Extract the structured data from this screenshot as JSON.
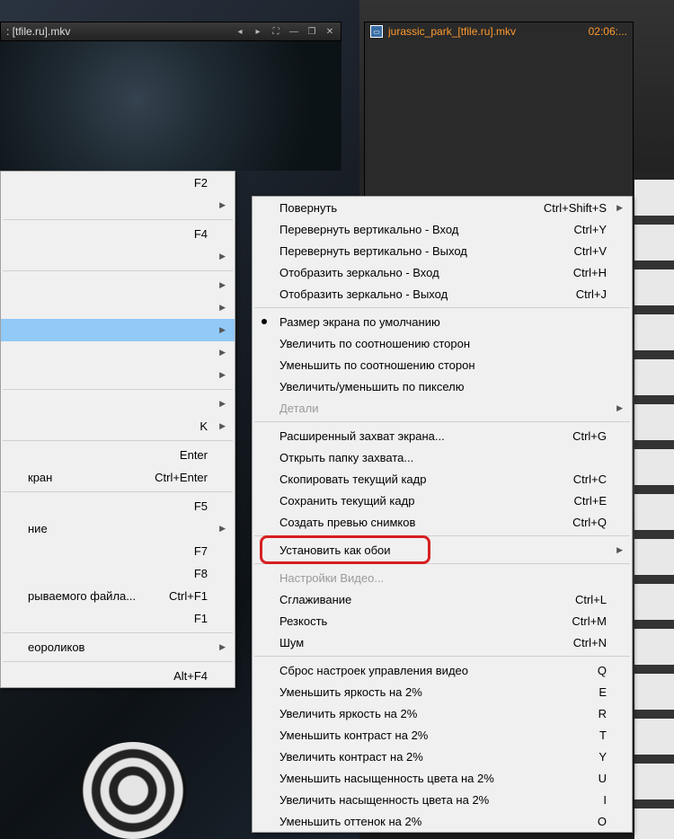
{
  "titlebar": {
    "title": ": [tfile.ru].mkv"
  },
  "playlist": {
    "filename": "jurassic_park_[tfile.ru].mkv",
    "duration": "02:06:..."
  },
  "menu_left": [
    {
      "label": "",
      "shortcut": "F2",
      "arrow": false
    },
    {
      "label": "",
      "shortcut": "",
      "arrow": true
    },
    {
      "sep": true
    },
    {
      "label": "",
      "shortcut": "F4",
      "arrow": false
    },
    {
      "label": "",
      "shortcut": "",
      "arrow": true
    },
    {
      "sep": true
    },
    {
      "label": "",
      "shortcut": "",
      "arrow": true
    },
    {
      "label": "",
      "shortcut": "",
      "arrow": true
    },
    {
      "label": "",
      "shortcut": "",
      "arrow": true,
      "highlight": true
    },
    {
      "label": "",
      "shortcut": "",
      "arrow": true
    },
    {
      "label": "",
      "shortcut": "",
      "arrow": true
    },
    {
      "sep": true
    },
    {
      "label": "",
      "shortcut": "",
      "arrow": true
    },
    {
      "label": "",
      "shortcut": "K",
      "arrow": true
    },
    {
      "sep": true
    },
    {
      "label": "",
      "shortcut": "Enter",
      "arrow": false
    },
    {
      "label": "кран",
      "shortcut": "Ctrl+Enter",
      "arrow": false
    },
    {
      "sep": true
    },
    {
      "label": "",
      "shortcut": "F5",
      "arrow": false
    },
    {
      "label": "ние",
      "shortcut": "",
      "arrow": true
    },
    {
      "label": "",
      "shortcut": "F7",
      "arrow": false
    },
    {
      "label": "",
      "shortcut": "F8",
      "arrow": false
    },
    {
      "label": "рываемого файла...",
      "shortcut": "Ctrl+F1",
      "arrow": false
    },
    {
      "label": "",
      "shortcut": "F1",
      "arrow": false
    },
    {
      "sep": true
    },
    {
      "label": "еороликов",
      "shortcut": "",
      "arrow": true
    },
    {
      "sep": true
    },
    {
      "label": "",
      "shortcut": "Alt+F4",
      "arrow": false
    }
  ],
  "menu_right": [
    {
      "label": "Повернуть",
      "shortcut": "Ctrl+Shift+S",
      "arrow": true
    },
    {
      "label": "Перевернуть вертикально - Вход",
      "shortcut": "Ctrl+Y"
    },
    {
      "label": "Перевернуть вертикально - Выход",
      "shortcut": "Ctrl+V"
    },
    {
      "label": "Отобразить зеркально - Вход",
      "shortcut": "Ctrl+H"
    },
    {
      "label": "Отобразить зеркально - Выход",
      "shortcut": "Ctrl+J"
    },
    {
      "sep": true
    },
    {
      "label": "Размер экрана по умолчанию",
      "bullet": true
    },
    {
      "label": "Увеличить по соотношению сторон"
    },
    {
      "label": "Уменьшить по соотношению сторон"
    },
    {
      "label": "Увеличить/уменьшить по пикселю"
    },
    {
      "label": "Детали",
      "disabled": true,
      "arrow": true
    },
    {
      "sep": true
    },
    {
      "label": "Расширенный захват экрана...",
      "shortcut": "Ctrl+G"
    },
    {
      "label": "Открыть папку захвата..."
    },
    {
      "label": "Скопировать текущий кадр",
      "shortcut": "Ctrl+C"
    },
    {
      "label": "Сохранить текущий кадр",
      "shortcut": "Ctrl+E"
    },
    {
      "label": "Создать превью снимков",
      "shortcut": "Ctrl+Q"
    },
    {
      "sep": true
    },
    {
      "label": "Установить как обои",
      "arrow": true,
      "callout": true
    },
    {
      "sep": true
    },
    {
      "label": "Настройки Видео...",
      "disabled": true
    },
    {
      "label": "Сглаживание",
      "shortcut": "Ctrl+L"
    },
    {
      "label": "Резкость",
      "shortcut": "Ctrl+M"
    },
    {
      "label": "Шум",
      "shortcut": "Ctrl+N"
    },
    {
      "sep": true
    },
    {
      "label": "Сброс настроек управления видео",
      "shortcut": "Q"
    },
    {
      "label": "Уменьшить яркость на 2%",
      "shortcut": "E"
    },
    {
      "label": "Увеличить яркость на 2%",
      "shortcut": "R"
    },
    {
      "label": "Уменьшить контраст на 2%",
      "shortcut": "T"
    },
    {
      "label": "Увеличить контраст на 2%",
      "shortcut": "Y"
    },
    {
      "label": "Уменьшить насыщенность цвета на 2%",
      "shortcut": "U"
    },
    {
      "label": "Увеличить насыщенность цвета на 2%",
      "shortcut": "I"
    },
    {
      "label": "Уменьшить оттенок на 2%",
      "shortcut": "O"
    }
  ]
}
